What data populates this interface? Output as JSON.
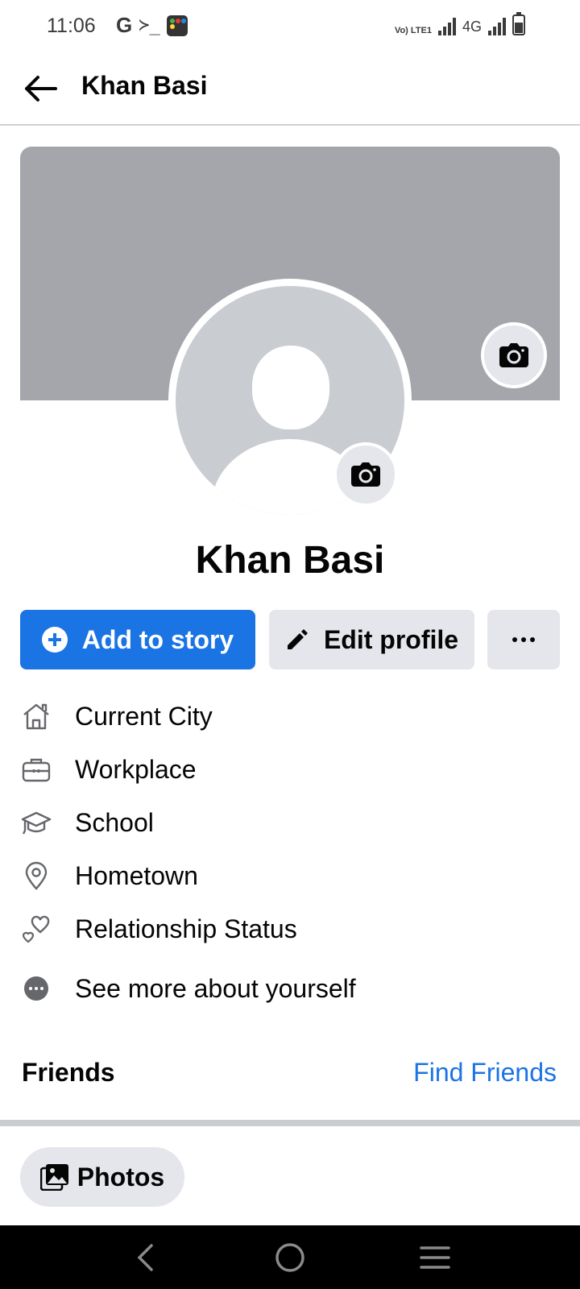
{
  "status_bar": {
    "time": "11:06",
    "left_icons": [
      "google-icon",
      "terminal-icon",
      "app-launcher-icon"
    ],
    "g_label": "G",
    "terminal_label": "≻_",
    "volte_label": "Vo) LTE1",
    "network_label": "4G",
    "right_icons": [
      "volte-icon",
      "signal-icon",
      "4g-icon",
      "signal-icon",
      "battery-icon"
    ]
  },
  "header": {
    "title": "Khan Basi",
    "back_icon": "arrow-left-icon"
  },
  "profile": {
    "name": "Khan Basi",
    "cover_color": "#a4a6ab",
    "avatar_color": "#c9ccd1"
  },
  "actions": {
    "add_story_label": "Add to story",
    "edit_profile_label": "Edit profile",
    "more_label": "···"
  },
  "about": {
    "items": [
      {
        "icon": "home-icon",
        "label": "Current City"
      },
      {
        "icon": "briefcase-icon",
        "label": "Workplace"
      },
      {
        "icon": "graduation-cap-icon",
        "label": "School"
      },
      {
        "icon": "location-pin-icon",
        "label": "Hometown"
      },
      {
        "icon": "hearts-icon",
        "label": "Relationship Status"
      },
      {
        "icon": "more-dots-icon",
        "label": "See more about yourself"
      }
    ]
  },
  "friends": {
    "title": "Friends",
    "find_friends_label": "Find Friends"
  },
  "photos": {
    "label": "Photos"
  },
  "colors": {
    "accent": "#1b74e4",
    "button_gray": "#e4e6eb",
    "text": "#050505"
  },
  "nav_bar": {
    "buttons": [
      "back-nav-icon",
      "home-nav-icon",
      "recents-nav-icon"
    ]
  }
}
